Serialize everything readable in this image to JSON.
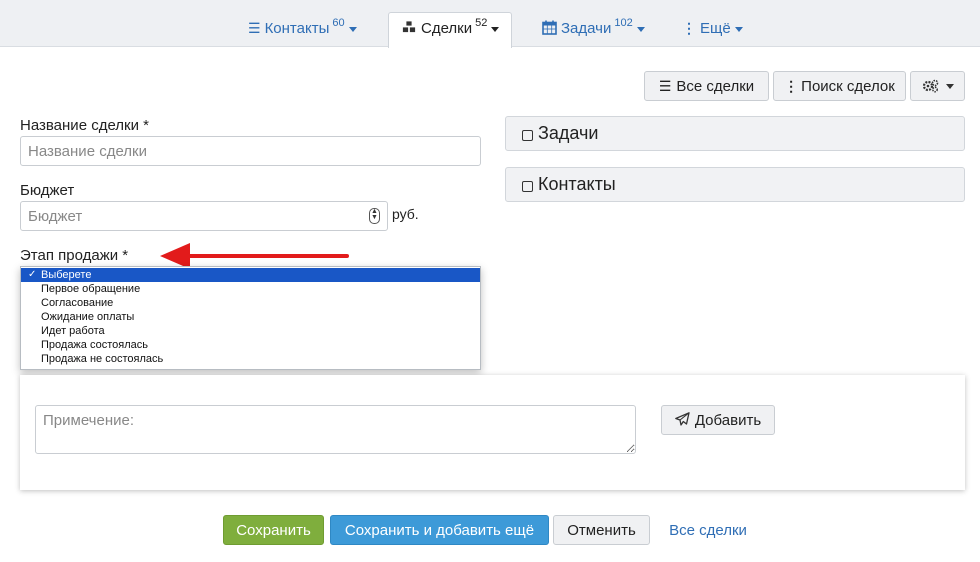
{
  "nav": {
    "tabs": [
      {
        "label": "Контакты",
        "count": "60",
        "icon": "list-icon"
      },
      {
        "label": "Сделки",
        "count": "52",
        "icon": "cubes-icon"
      },
      {
        "label": "Задачи",
        "count": "102",
        "icon": "calendar-icon"
      },
      {
        "label": "Ещё",
        "count": "",
        "icon": "ellipsis-vertical-icon"
      }
    ],
    "active_tab": "Сделки"
  },
  "toolbar": {
    "all_deals_label": "Все сделки",
    "search_deals_label": "Поиск сделок",
    "settings_icon": "gears-icon"
  },
  "form": {
    "name_label": "Название сделки *",
    "name_placeholder": "Название сделки",
    "budget_label": "Бюджет",
    "budget_placeholder": "Бюджет",
    "currency": "руб.",
    "stage_label": "Этап продажи *",
    "stage_options": [
      "Выберете",
      "Первое обращение",
      "Согласование",
      "Ожидание оплаты",
      "Идет работа",
      "Продажа состоялась",
      "Продажа не состоялась"
    ],
    "stage_selected": "Выберете"
  },
  "panels": {
    "tasks_label": "Задачи",
    "contacts_label": "Контакты"
  },
  "note": {
    "placeholder": "Примечение:",
    "add_label": "Добавить"
  },
  "footer": {
    "save_label": "Сохранить",
    "save_add_label": "Сохранить и добавить ещё",
    "cancel_label": "Отменить",
    "all_deals_link": "Все сделки"
  },
  "colors": {
    "accent_link": "#2f6eb5",
    "save_green": "#7fae3d",
    "save_add_blue": "#3d9ad8",
    "dropdown_selected": "#1957c6",
    "annotation_arrow": "#e21b1b"
  }
}
